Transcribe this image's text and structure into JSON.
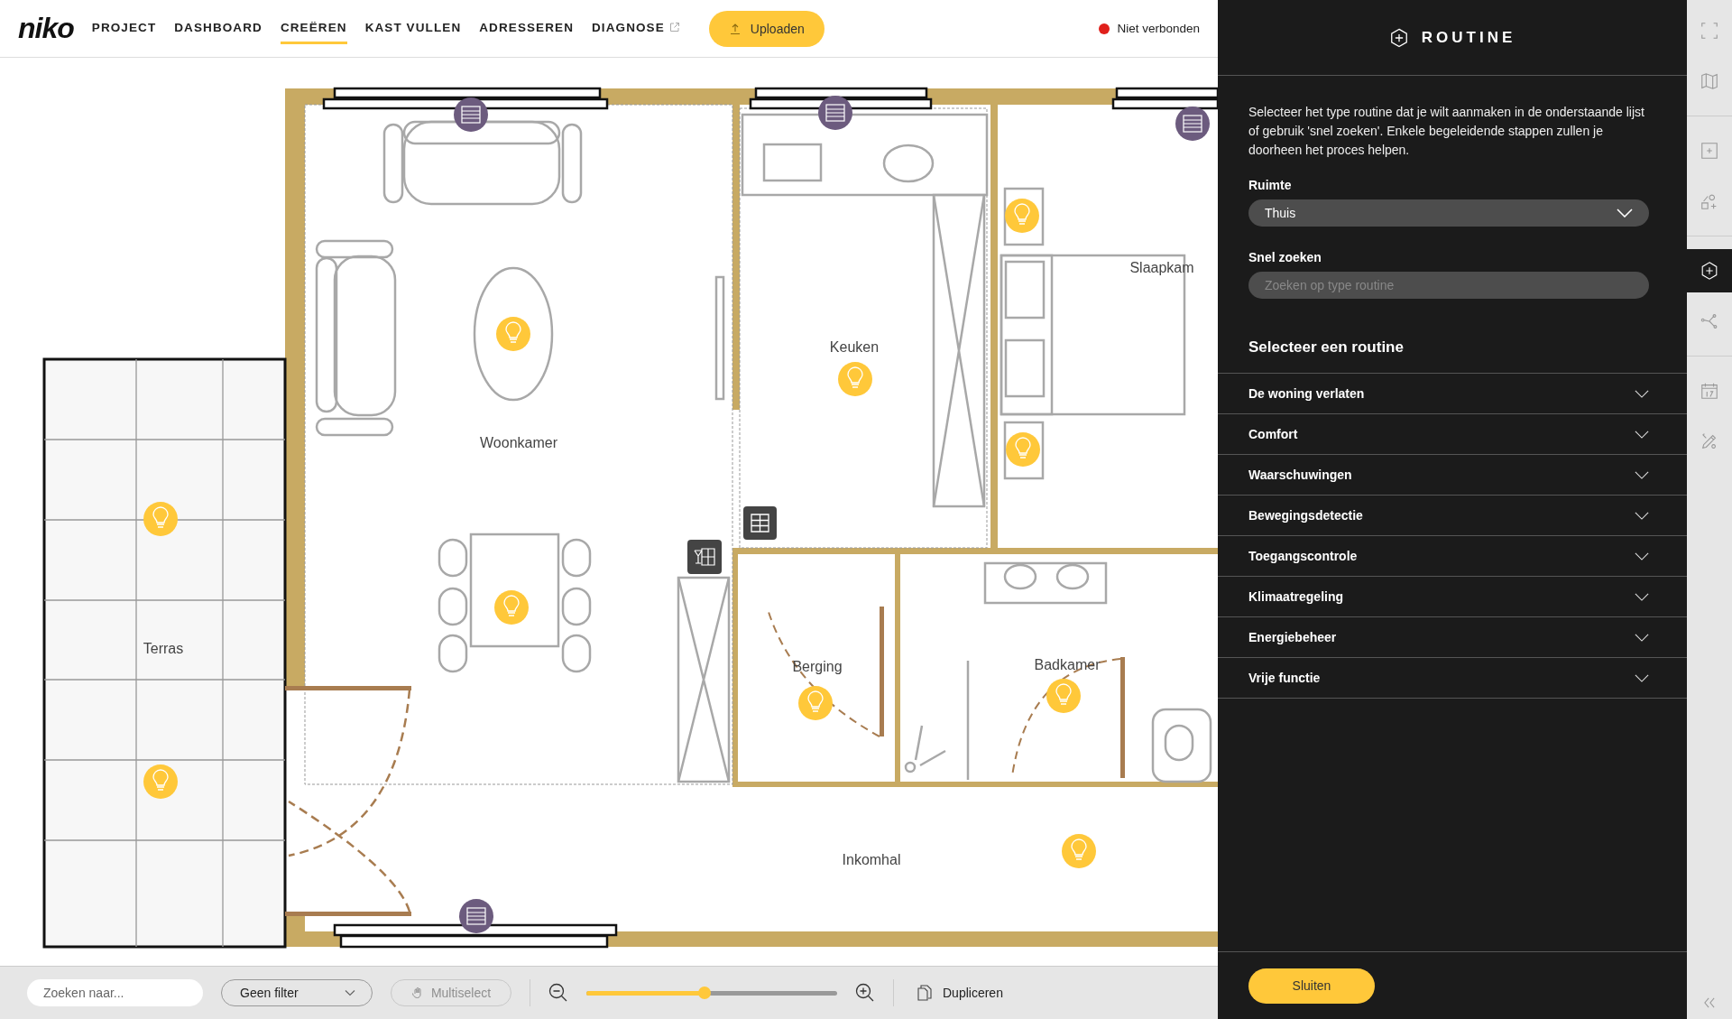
{
  "header": {
    "logo": "niko",
    "nav": [
      {
        "label": "PROJECT",
        "selected": false,
        "external": false
      },
      {
        "label": "DASHBOARD",
        "selected": false,
        "external": false
      },
      {
        "label": "CREËREN",
        "selected": true,
        "external": false
      },
      {
        "label": "KAST VULLEN",
        "selected": false,
        "external": false
      },
      {
        "label": "ADRESSEREN",
        "selected": false,
        "external": false
      },
      {
        "label": "DIAGNOSE",
        "selected": false,
        "external": true
      }
    ],
    "upload_button": "Uploaden",
    "status": {
      "label": "Niet verbonden",
      "connected": false
    }
  },
  "floor_plan": {
    "rooms": [
      "Woonkamer",
      "Keuken",
      "Slaapkam",
      "Terras",
      "Berging",
      "Badkamer",
      "Inkomhal"
    ]
  },
  "bottom_bar": {
    "search": {
      "placeholder": "Zoeken naar..."
    },
    "filter": {
      "value": "Geen filter"
    },
    "multiselect": {
      "label": "Multiselect",
      "disabled": true
    },
    "zoom": {
      "level": 0.47
    },
    "duplicate": "Dupliceren"
  },
  "panel": {
    "title": "ROUTINE",
    "description": "Selecteer het type routine dat je wilt aanmaken in de onderstaande lijst of gebruik 'snel zoeken'. Enkele begeleidende stappen zullen je doorheen het proces helpen.",
    "room_field": {
      "label": "Ruimte",
      "value": "Thuis"
    },
    "search_field": {
      "label": "Snel zoeken",
      "placeholder": "Zoeken op type routine"
    },
    "section_title": "Selecteer een routine",
    "categories": [
      {
        "label": "De woning verlaten",
        "expanded": false
      },
      {
        "label": "Comfort",
        "expanded": false
      },
      {
        "label": "Waarschuwingen",
        "expanded": false
      },
      {
        "label": "Bewegingsdetectie",
        "expanded": false
      },
      {
        "label": "Toegangscontrole",
        "expanded": false
      },
      {
        "label": "Klimaatregeling",
        "expanded": false
      },
      {
        "label": "Energiebeheer",
        "expanded": false
      },
      {
        "label": "Vrije functie",
        "expanded": false
      }
    ],
    "close_button": "Sluiten"
  },
  "rail": [
    {
      "kind": "fullscreen",
      "selected": false
    },
    {
      "kind": "map",
      "selected": false
    },
    {
      "kind": "add",
      "selected": false
    },
    {
      "kind": "shapes",
      "selected": false
    },
    {
      "kind": "routine",
      "selected": true
    },
    {
      "kind": "nodes",
      "selected": false
    },
    {
      "kind": "calendar",
      "selected": false
    },
    {
      "kind": "tools",
      "selected": false
    }
  ]
}
